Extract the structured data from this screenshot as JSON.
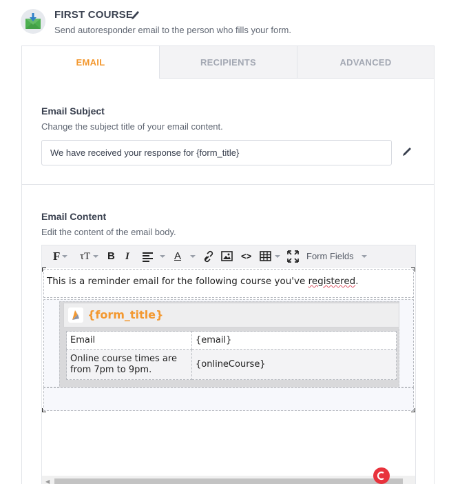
{
  "header": {
    "title": "FIRST COURSE",
    "subtitle": "Send autoresponder email to the person who fills your form.",
    "icon": "envelope-download-icon",
    "edit_icon": "pencil-icon"
  },
  "tabs": [
    {
      "label": "EMAIL",
      "active": true
    },
    {
      "label": "RECIPIENTS",
      "active": false
    },
    {
      "label": "ADVANCED",
      "active": false
    }
  ],
  "subject": {
    "title": "Email Subject",
    "description": "Change the subject title of your email content.",
    "value": "We have received your response for {form_title}"
  },
  "content": {
    "title": "Email Content",
    "description": "Edit the content of the email body."
  },
  "toolbar": {
    "form_fields_label": "Form Fields",
    "icons": [
      "font-family-icon",
      "font-size-icon",
      "bold-icon",
      "italic-icon",
      "align-icon",
      "font-color-icon",
      "link-icon",
      "image-icon",
      "code-icon",
      "table-icon",
      "fullscreen-icon"
    ]
  },
  "editor": {
    "reminder_text": "This is a reminder email for the following course you've ",
    "reminder_word": "registered",
    "reminder_end": ".",
    "form_title": "{form_title}",
    "rows": [
      {
        "label": "Email",
        "value": "{email}"
      },
      {
        "label": "Online course times are from 7pm to 9pm.",
        "value": "{onlineCourse}"
      }
    ]
  },
  "colors": {
    "accent": "#f3982f",
    "text": "#39404f",
    "muted": "#5f6672"
  }
}
